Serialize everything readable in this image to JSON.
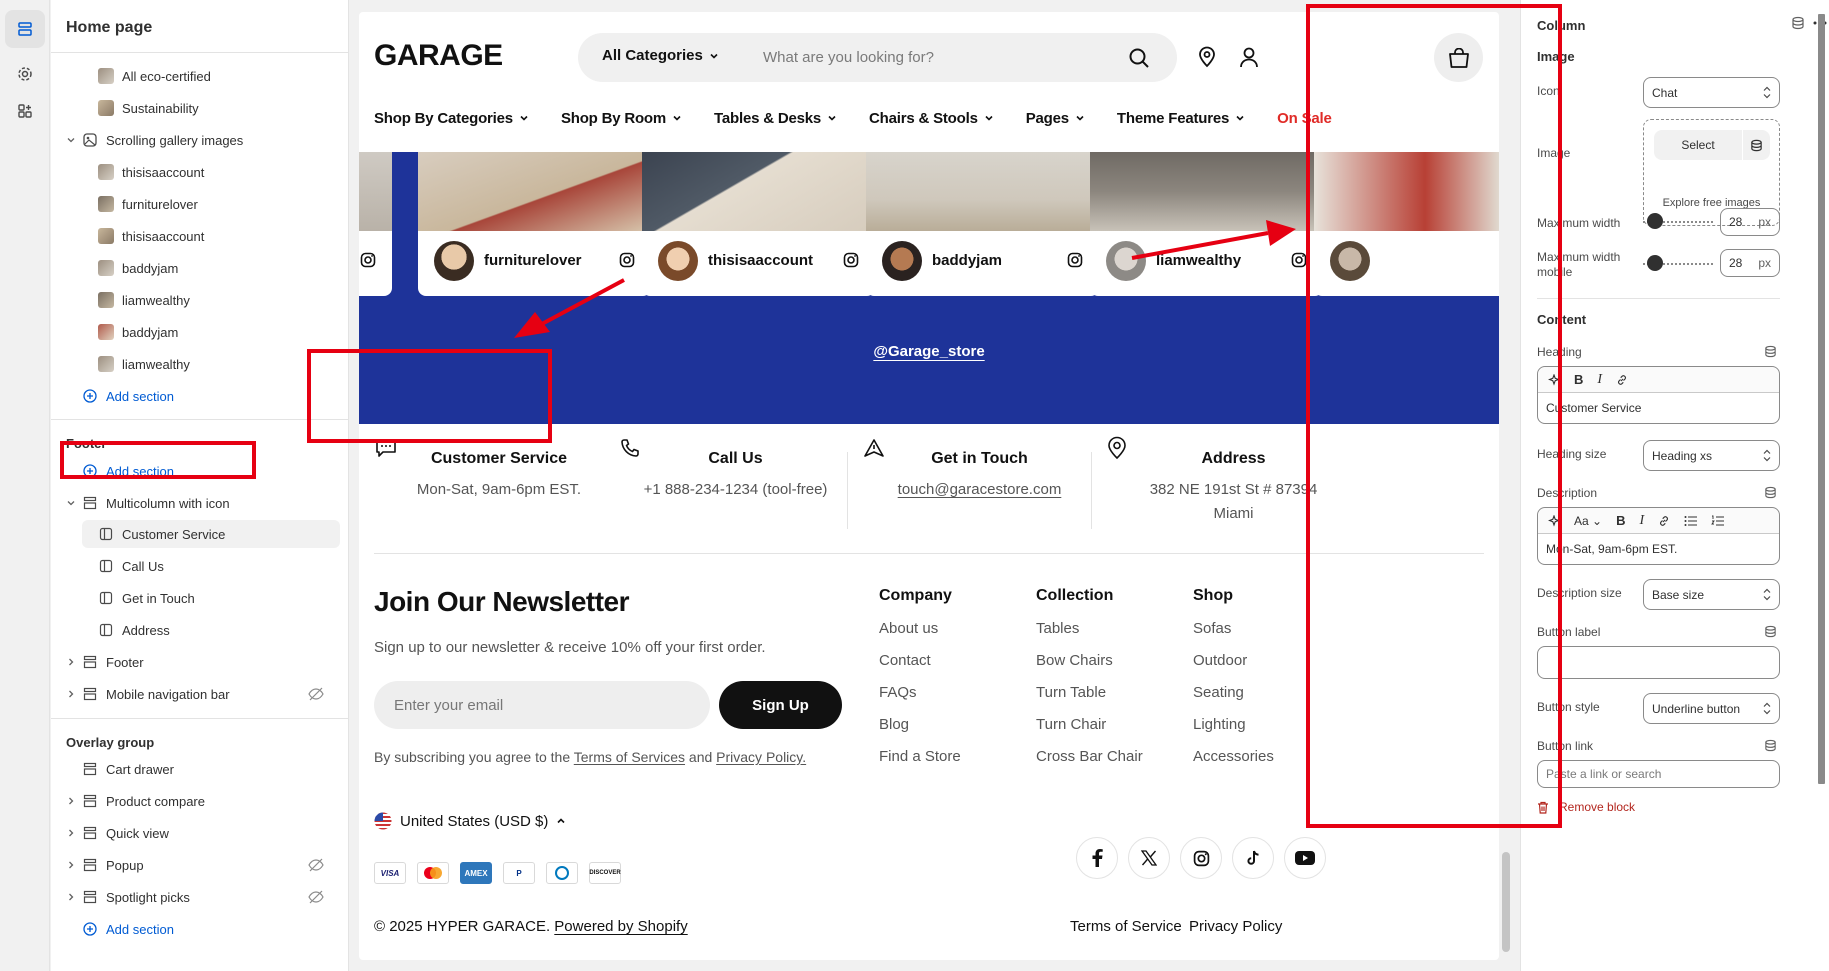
{
  "sidebar": {
    "title": "Home page",
    "items": [
      {
        "label": "All eco-certified"
      },
      {
        "label": "Sustainability"
      },
      {
        "label": "Scrolling gallery images"
      },
      {
        "label": "thisisaaccount"
      },
      {
        "label": "furniturelover"
      },
      {
        "label": "thisisaaccount"
      },
      {
        "label": "baddyjam"
      },
      {
        "label": "liamwealthy"
      },
      {
        "label": "baddyjam"
      },
      {
        "label": "liamwealthy"
      }
    ],
    "add_section": "Add section",
    "footer_group": "Footer",
    "footer_items": [
      {
        "label": "Multicolumn with icon"
      },
      {
        "label": "Customer Service"
      },
      {
        "label": "Call Us"
      },
      {
        "label": "Get in Touch"
      },
      {
        "label": "Address"
      },
      {
        "label": "Footer"
      },
      {
        "label": "Mobile navigation bar"
      }
    ],
    "overlay_group": "Overlay group",
    "overlay_items": [
      {
        "label": "Cart drawer"
      },
      {
        "label": "Product compare"
      },
      {
        "label": "Quick view"
      },
      {
        "label": "Popup"
      },
      {
        "label": "Spotlight picks"
      }
    ]
  },
  "store": {
    "logo": "GARAGE",
    "category_select": "All Categories",
    "search_placeholder": "What are you looking for?",
    "nav": [
      "Shop By Categories",
      "Shop By Room",
      "Tables & Desks",
      "Chairs & Stools",
      "Pages",
      "Theme Features",
      "On Sale"
    ],
    "gallery": [
      {
        "name": "furniturelover"
      },
      {
        "name": "thisisaaccount"
      },
      {
        "name": "baddyjam"
      },
      {
        "name": "liamwealthy"
      }
    ],
    "store_handle": "@Garage_store",
    "columns": [
      {
        "heading": "Customer Service",
        "desc": "Mon-Sat, 9am-6pm EST."
      },
      {
        "heading": "Call Us",
        "desc": "+1 888-234-1234 (tool-free)"
      },
      {
        "heading": "Get in Touch",
        "desc": "touch@garacestore.com"
      },
      {
        "heading": "Address",
        "desc_line1": "382 NE 191st St # 87394",
        "desc_line2": "Miami"
      }
    ],
    "newsletter": {
      "title": "Join Our Newsletter",
      "subtitle": "Sign up to our newsletter & receive 10% off your first order.",
      "email_placeholder": "Enter your email",
      "button": "Sign Up",
      "consent_pre": "By subscribing you agree to the ",
      "consent_terms": "Terms of Services",
      "consent_and": " and ",
      "consent_privacy": "Privacy Policy."
    },
    "footer_cols": [
      {
        "title": "Company",
        "links": [
          "About us",
          "Contact",
          "FAQs",
          "Blog",
          "Find a Store"
        ]
      },
      {
        "title": "Collection",
        "links": [
          "Tables",
          "Bow Chairs",
          "Turn Table",
          "Turn Chair",
          "Cross Bar Chair"
        ]
      },
      {
        "title": "Shop",
        "links": [
          "Sofas",
          "Outdoor",
          "Seating",
          "Lighting",
          "Accessories"
        ]
      }
    ],
    "currency": "United States (USD $)",
    "payments": [
      "VISA",
      "MC",
      "AMEX",
      "PayPal",
      "Diners",
      "DISCOVER"
    ],
    "copyright": "© 2025 HYPER GARACE. ",
    "powered": "Powered by Shopify",
    "terms": "Terms of Service",
    "privacy": "Privacy Policy"
  },
  "panel": {
    "title": "Column",
    "image_section": "Image",
    "icon_label": "Icon",
    "icon_value": "Chat",
    "image_label": "Image",
    "select_btn": "Select",
    "explore": "Explore free images",
    "max_width_label": "Maximum width",
    "max_width_value": "28",
    "max_width_mobile_label": "Maximum width mobile",
    "max_width_mobile_value": "28",
    "unit": "px",
    "content_section": "Content",
    "heading_label": "Heading",
    "heading_value": "Customer Service",
    "heading_size_label": "Heading size",
    "heading_size_value": "Heading xs",
    "description_label": "Description",
    "description_value": "Mon-Sat, 9am-6pm EST.",
    "description_size_label": "Description size",
    "description_size_value": "Base size",
    "button_label_label": "Button label",
    "button_label_value": "",
    "button_style_label": "Button style",
    "button_style_value": "Underline button",
    "button_link_label": "Button link",
    "button_link_placeholder": "Paste a link or search",
    "remove": "Remove block"
  },
  "colors": {
    "accent_blue": "#1e3399",
    "highlight_red": "#e60012",
    "sale_red": "#e02b27",
    "link_blue": "#005bd3"
  }
}
